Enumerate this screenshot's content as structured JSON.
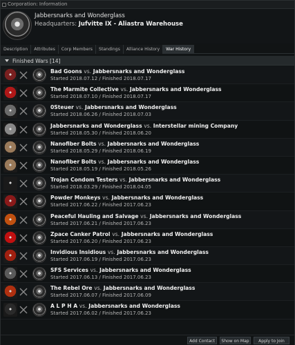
{
  "window": {
    "title": "Corporation: Information"
  },
  "corp": {
    "name": "Jabbersnarks and Wonderglass",
    "hq_label": "Headquarters:",
    "hq_value": "Jufvitte IX - Aliastra Warehouse"
  },
  "tabs": [
    {
      "label": "Description"
    },
    {
      "label": "Attributes"
    },
    {
      "label": "Corp Members"
    },
    {
      "label": "Standings"
    },
    {
      "label": "Alliance History"
    },
    {
      "label": "War History",
      "active": true
    }
  ],
  "section": {
    "label": "Finished Wars [14]"
  },
  "vs_text": "vs.",
  "wars": [
    {
      "attacker": "Bad Goons",
      "defender": "Jabbersnarks and Wonderglass",
      "dates": "Started 2018.07.12 / Finished 2018.07.17",
      "icon": "bad-goons-logo",
      "color": "#7a2020"
    },
    {
      "attacker": "The Marmite Collective",
      "defender": "Jabbersnarks and Wonderglass",
      "dates": "Started 2018.07.10 / Finished 2018.07.17",
      "icon": "marmite-collective-logo",
      "color": "#b01818"
    },
    {
      "attacker": "0Steuer",
      "defender": "Jabbersnarks and Wonderglass",
      "dates": "Started 2018.06.26 / Finished 2018.07.03",
      "icon": "0steuer-logo",
      "color": "#6a6a6a"
    },
    {
      "attacker": "Jabbersnarks and Wonderglass",
      "defender": "Interstellar mining Company",
      "dates": "Started 2018.05.30 / Finished 2018.06.20",
      "icon": "jabbersnarks-logo",
      "color": "#888888"
    },
    {
      "attacker": "Nanofiber Bolts",
      "defender": "Jabbersnarks and Wonderglass",
      "dates": "Started 2018.05.29 / Finished 2018.06.19",
      "icon": "nanofiber-bolts-portrait",
      "color": "#9a7a5a"
    },
    {
      "attacker": "Nanofiber Bolts",
      "defender": "Jabbersnarks and Wonderglass",
      "dates": "Started 2018.05.19 / Finished 2018.05.26",
      "icon": "nanofiber-bolts-portrait",
      "color": "#9a7a5a"
    },
    {
      "attacker": "Trojan Condom Testers",
      "defender": "Jabbersnarks and Wonderglass",
      "dates": "Started 2018.03.29 / Finished 2018.04.05",
      "icon": "trojan-condom-testers-logo",
      "color": "#1a1a1a"
    },
    {
      "attacker": "Powder Monkeys",
      "defender": "Jabbersnarks and Wonderglass",
      "dates": "Started 2017.06.22 / Finished 2017.06.23",
      "icon": "powder-monkeys-logo",
      "color": "#8a1a1a"
    },
    {
      "attacker": "Peaceful Hauling and Salvage",
      "defender": "Jabbersnarks and Wonderglass",
      "dates": "Started 2017.06.21 / Finished 2017.06.23",
      "icon": "peaceful-hauling-logo",
      "color": "#c05010"
    },
    {
      "attacker": "Zpace Canker Patrol",
      "defender": "Jabbersnarks and Wonderglass",
      "dates": "Started 2017.06.20 / Finished 2017.06.23",
      "icon": "zpace-canker-patrol-logo",
      "color": "#c01010"
    },
    {
      "attacker": "Invidious Insidious",
      "defender": "Jabbersnarks and Wonderglass",
      "dates": "Started 2017.06.19 / Finished 2017.06.23",
      "icon": "invidious-insidious-logo",
      "color": "#a02010"
    },
    {
      "attacker": "SFS Services",
      "defender": "Jabbersnarks and Wonderglass",
      "dates": "Started 2017.06.13 / Finished 2017.06.23",
      "icon": "sfs-services-logo",
      "color": "#5a5a5a"
    },
    {
      "attacker": "The Rebel Ore",
      "defender": "Jabbersnarks and Wonderglass",
      "dates": "Started 2017.06.07 / Finished 2017.06.09",
      "icon": "rebel-ore-logo",
      "color": "#b03010"
    },
    {
      "attacker": "A L P H A",
      "defender": "Jabbersnarks and Wonderglass",
      "dates": "Started 2017.06.02 / Finished 2017.06.23",
      "icon": "alpha-logo",
      "color": "#2a2a2a"
    }
  ],
  "footer": {
    "add_contact": "Add Contact",
    "show_on_map": "Show on Map",
    "apply_to_join": "Apply to Join"
  },
  "colors": {
    "background": "#111415",
    "tab_active": "#2b3033",
    "section_bar": "#252a2c",
    "text": "#d8d8d8"
  }
}
